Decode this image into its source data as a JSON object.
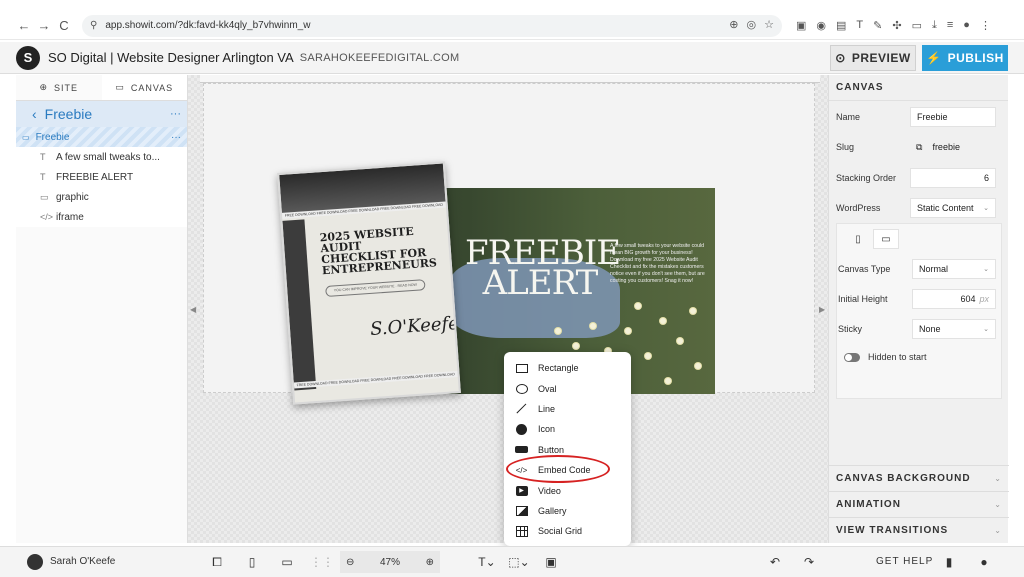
{
  "browser": {
    "url": "app.showit.com/?dk:favd-kk4qly_b7vhwinm_w",
    "back_icon": "←",
    "forward_icon": "→",
    "reload_icon": "C"
  },
  "header": {
    "logo_letter": "S",
    "site_title": "SO Digital | Website Designer Arlington VA",
    "site_domain": "SARAHOKEEFEDIGITAL.COM",
    "preview_label": "PREVIEW",
    "publish_label": "PUBLISH",
    "publish_color": "#2a9ed8"
  },
  "left_panel": {
    "tabs": [
      {
        "label": "SITE",
        "icon": "globe-icon"
      },
      {
        "label": "CANVAS",
        "icon": "canvas-icon"
      }
    ],
    "page_name": "Freebie",
    "canvas_name": "Freebie",
    "layers": [
      {
        "label": "A few small tweaks to...",
        "icon": "text-icon",
        "glyph": "T"
      },
      {
        "label": "FREEBIE ALERT",
        "icon": "text-icon",
        "glyph": "T"
      },
      {
        "label": "graphic",
        "icon": "image-icon",
        "glyph": "▭"
      },
      {
        "label": "iframe",
        "icon": "code-icon",
        "glyph": "</>"
      }
    ]
  },
  "canvas": {
    "hero_title": "FREEBIE ALERT",
    "hero_copy": "A few small tweaks to your website could mean BIG growth for your business! Download my free 2025 Website Audit Checklist and fix the mistakes customers notice even if you don't see them, but are costing you customers! Snag it now!",
    "checklist_title": "2025 WEBSITE AUDIT CHECKLIST FOR ENTREPRENEURS",
    "checklist_pill": "YOU CAN IMPROVE YOUR WEBSITE · READ NOW",
    "checklist_strip": "FREE DOWNLOAD FREE DOWNLOAD FREE DOWNLOAD FREE DOWNLOAD FREE DOWNLOAD",
    "checklist_signature": "S.O'Keefe"
  },
  "add_menu": {
    "items": [
      {
        "label": "Rectangle",
        "icon": "rectangle-icon"
      },
      {
        "label": "Oval",
        "icon": "oval-icon"
      },
      {
        "label": "Line",
        "icon": "line-icon"
      },
      {
        "label": "Icon",
        "icon": "smiley-icon"
      },
      {
        "label": "Button",
        "icon": "button-icon"
      },
      {
        "label": "Embed Code",
        "icon": "code-icon"
      },
      {
        "label": "Video",
        "icon": "video-icon"
      },
      {
        "label": "Gallery",
        "icon": "gallery-icon"
      },
      {
        "label": "Social Grid",
        "icon": "grid-icon"
      }
    ],
    "highlight_color": "#d62222"
  },
  "right_panel": {
    "title": "CANVAS",
    "name_label": "Name",
    "name_value": "Freebie",
    "slug_label": "Slug",
    "slug_value": "freebie",
    "stacking_label": "Stacking Order",
    "stacking_value": "6",
    "wordpress_label": "WordPress",
    "wordpress_value": "Static Content",
    "canvas_type_label": "Canvas Type",
    "canvas_type_value": "Normal",
    "initial_height_label": "Initial Height",
    "initial_height_value": "604",
    "initial_height_unit": "px",
    "sticky_label": "Sticky",
    "sticky_value": "None",
    "hidden_label": "Hidden to start",
    "sections": [
      "CANVAS BACKGROUND",
      "ANIMATION",
      "VIEW TRANSITIONS"
    ]
  },
  "bottom_bar": {
    "user_name": "Sarah O'Keefe",
    "zoom": "47%",
    "help_label": "GET HELP"
  }
}
